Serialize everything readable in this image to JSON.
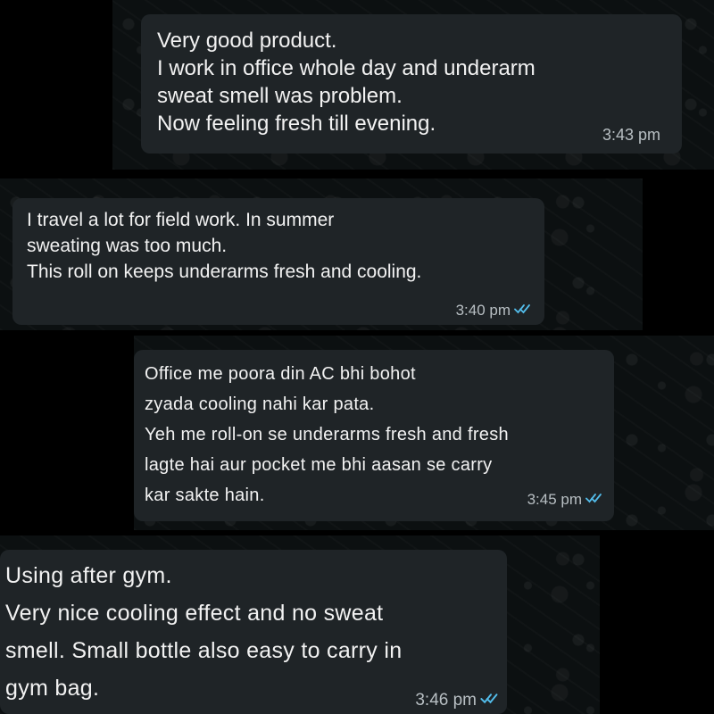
{
  "messages": [
    {
      "lines": [
        "Very good product.",
        "I work in office whole day and underarm",
        "sweat smell was problem.",
        "Now feeling fresh till evening."
      ],
      "time": "3:43 pm",
      "read_receipt": false
    },
    {
      "lines": [
        "I travel a lot for field work. In summer",
        "sweating was too much.",
        "This roll on keeps underarms fresh and cooling."
      ],
      "time": "3:40 pm",
      "read_receipt": true
    },
    {
      "lines": [
        "Office me poora din AC bhi bohot",
        "zyada cooling nahi kar pata.",
        "Yeh me roll-on se underarms fresh and fresh",
        "lagte hai aur pocket me bhi aasan se carry",
        "kar sakte hain."
      ],
      "time": "3:45 pm",
      "read_receipt": true
    },
    {
      "lines": [
        "Using after gym.",
        "Very nice cooling effect and no sweat",
        "smell. Small bottle also easy to carry in",
        "gym bag."
      ],
      "time": "3:46 pm",
      "read_receipt": true
    }
  ],
  "colors": {
    "background": "#0c1011",
    "bubble": "#1f2427",
    "text": "#f2f2f2",
    "timestamp": "#b8bfc3",
    "read_tick": "#53bdeb"
  },
  "icons": {
    "read_receipt": "double-check-icon"
  }
}
